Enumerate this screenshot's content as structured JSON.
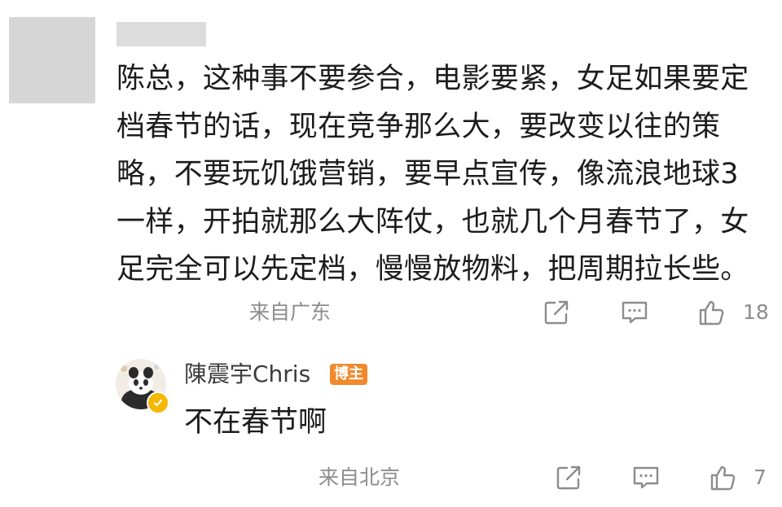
{
  "comment": {
    "lines": [
      "陈总，这种事不要参合，电影要紧，女足如果要定",
      "档春节的话，现在竞争那么大，要改变以往的策",
      "略，不要玩饥饿营销，要早点宣传，像流浪地球3",
      "一样，开拍就那么大阵仗，也就几个月春节了，女",
      "足完全可以先定档，慢慢放物料，把周期拉长些。"
    ],
    "location": "来自广东",
    "like_count": "18"
  },
  "reply": {
    "author_name": "陳震宇Chris",
    "author_badge": "博主",
    "text": "不在春节啊",
    "location": "来自北京",
    "like_count": "7"
  },
  "icons": {
    "share": "share-icon",
    "comment": "comment-icon",
    "like": "thumbs-up-icon",
    "verified": "verified-badge-icon"
  },
  "colors": {
    "meta_gray": "#8c8c8c",
    "badge_orange": "#f08a2c",
    "verified_yellow": "#f5b700"
  }
}
